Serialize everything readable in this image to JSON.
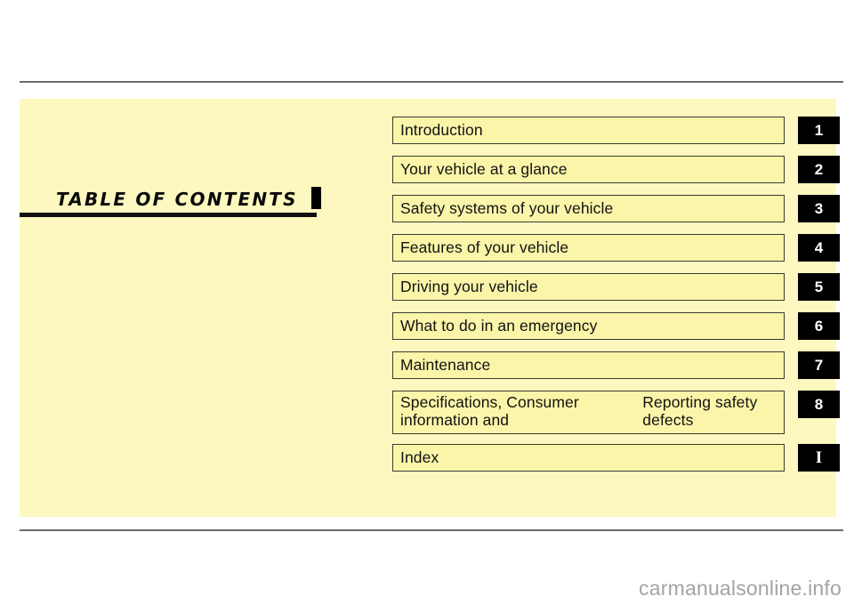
{
  "page": {
    "title": "TABLE  OF  CONTENTS",
    "watermark": "carmanualsonline.info",
    "colors": {
      "panel_background": "#fcf8bf",
      "row_fill": "#faf5a9",
      "row_border": "#3b3b30",
      "tab_background": "#000000",
      "tab_text": "#ffffff",
      "rule": "#6b6b6b",
      "watermark_text": "#a3a3a3"
    }
  },
  "contents": {
    "rows": [
      {
        "label": "Introduction",
        "label2": "",
        "tab": "1",
        "tab_style": "sans",
        "tall": false
      },
      {
        "label": "Your vehicle at a glance",
        "label2": "",
        "tab": "2",
        "tab_style": "sans",
        "tall": false
      },
      {
        "label": "Safety systems of your vehicle",
        "label2": "",
        "tab": "3",
        "tab_style": "sans",
        "tall": false
      },
      {
        "label": "Features of your vehicle",
        "label2": "",
        "tab": "4",
        "tab_style": "sans",
        "tall": false
      },
      {
        "label": "Driving your vehicle",
        "label2": "",
        "tab": "5",
        "tab_style": "sans",
        "tall": false
      },
      {
        "label": "What to do in an emergency",
        "label2": "",
        "tab": "6",
        "tab_style": "sans",
        "tall": false
      },
      {
        "label": "Maintenance",
        "label2": "",
        "tab": "7",
        "tab_style": "sans",
        "tall": false
      },
      {
        "label": "Specifications, Consumer information and",
        "label2": "Reporting safety defects",
        "tab": "8",
        "tab_style": "sans",
        "tall": true
      },
      {
        "label": "Index",
        "label2": "",
        "tab": "I",
        "tab_style": "serif",
        "tall": false
      }
    ]
  }
}
